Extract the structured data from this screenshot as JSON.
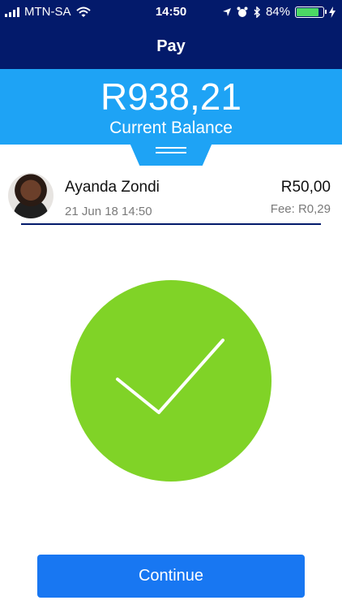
{
  "status_bar": {
    "carrier": "MTN-SA",
    "time": "14:50",
    "battery_percent": "84%",
    "battery_level": 0.84,
    "icons": [
      "signal-icon",
      "wifi-icon",
      "location-icon",
      "alarm-icon",
      "bluetooth-icon",
      "battery-icon",
      "charging-icon"
    ]
  },
  "header": {
    "title": "Pay"
  },
  "balance": {
    "amount": "R938,21",
    "label": "Current Balance"
  },
  "transaction": {
    "name": "Ayanda Zondi",
    "date": "21 Jun 18 14:50",
    "amount": "R50,00",
    "fee": "Fee: R0,29"
  },
  "success": {
    "icon": "checkmark-icon"
  },
  "actions": {
    "continue_label": "Continue"
  },
  "colors": {
    "navy": "#031a6b",
    "balance_blue": "#1ea3f5",
    "success_green": "#80d327",
    "button_blue": "#1877f2",
    "battery_green": "#4cd964"
  }
}
